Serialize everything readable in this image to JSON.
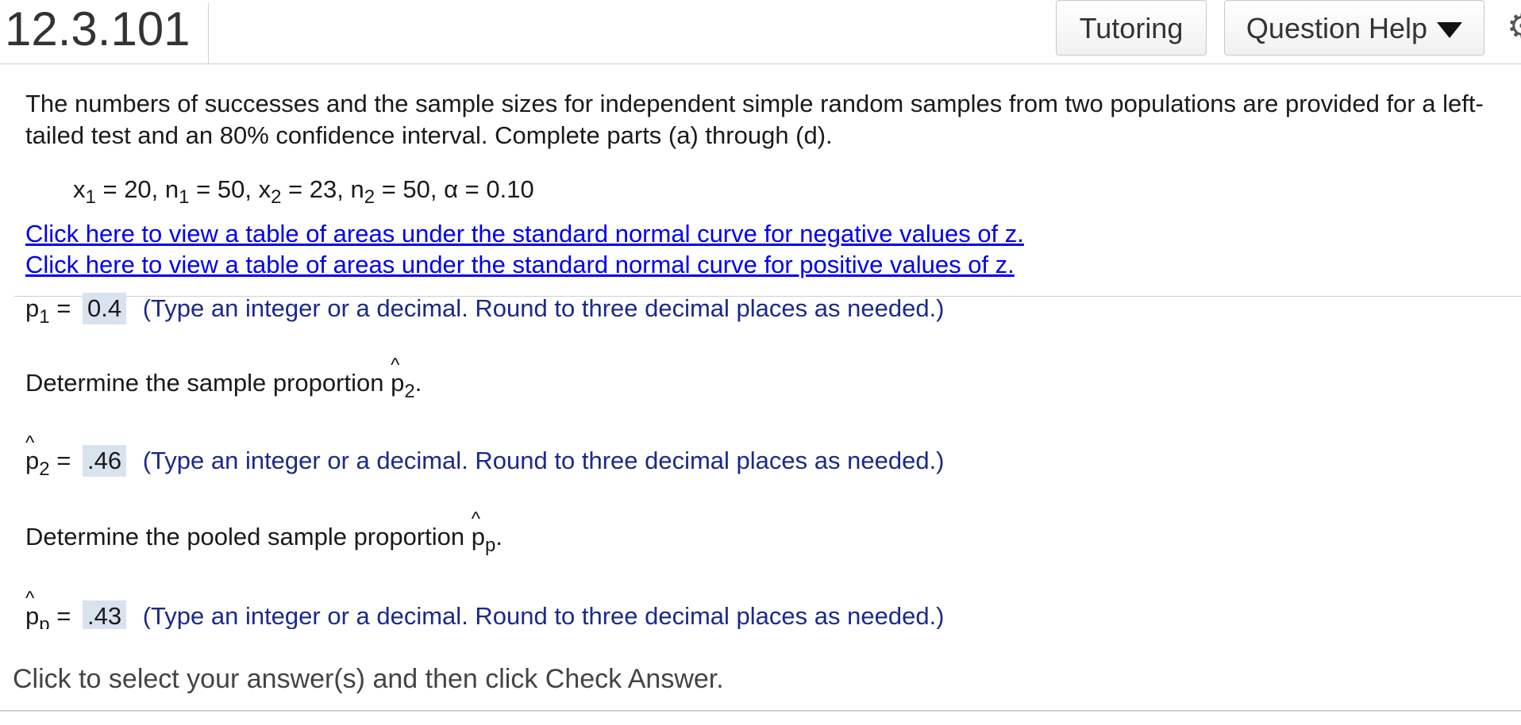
{
  "header": {
    "question_number": "12.3.101",
    "tutoring_label": "Tutoring",
    "question_help_label": "Question Help"
  },
  "problem": {
    "intro": "The numbers of successes and the sample sizes for independent simple random samples from two populations are provided for a left-tailed test and an 80% confidence interval. Complete parts (a) through (d).",
    "given": {
      "x1": "x",
      "x1_sub": "1",
      "x1_val": " = 20, ",
      "n1": "n",
      "n1_sub": "1",
      "n1_val": " = 50, ",
      "x2": "x",
      "x2_sub": "2",
      "x2_val": " = 23, ",
      "n2": "n",
      "n2_sub": "2",
      "n2_val": " = 50, ",
      "alpha": "α = 0.10"
    },
    "link_negative": "Click here to view a table of areas under the standard normal curve for negative values of z.",
    "link_positive": "Click here to view a table of areas under the standard normal curve for positive values of z."
  },
  "answers": {
    "p1": {
      "symbol": "p",
      "sub": "1",
      "equals": "=",
      "value": "0.4",
      "hint": "(Type an integer or a decimal. Round to three decimal places as needed.)"
    },
    "q2": {
      "text": "Determine the sample proportion ",
      "symbol": "p",
      "sub": "2",
      "end": "."
    },
    "p2": {
      "symbol": "p",
      "sub": "2",
      "equals": "=",
      "value": ".46",
      "hint": "(Type an integer or a decimal. Round to three decimal places as needed.)"
    },
    "q3": {
      "text": "Determine the pooled sample proportion ",
      "symbol": "p",
      "sub": "p",
      "end": "."
    },
    "pp": {
      "symbol": "p",
      "sub": "p",
      "equals": "=",
      "value": ".43",
      "hint": "(Type an integer or a decimal. Round to three decimal places as needed.)"
    }
  },
  "footer": {
    "instruction": "Click to select your answer(s) and then click Check Answer."
  },
  "icons": {
    "hat": "^",
    "gear": "⚙",
    "caret": "caret-down-icon"
  }
}
